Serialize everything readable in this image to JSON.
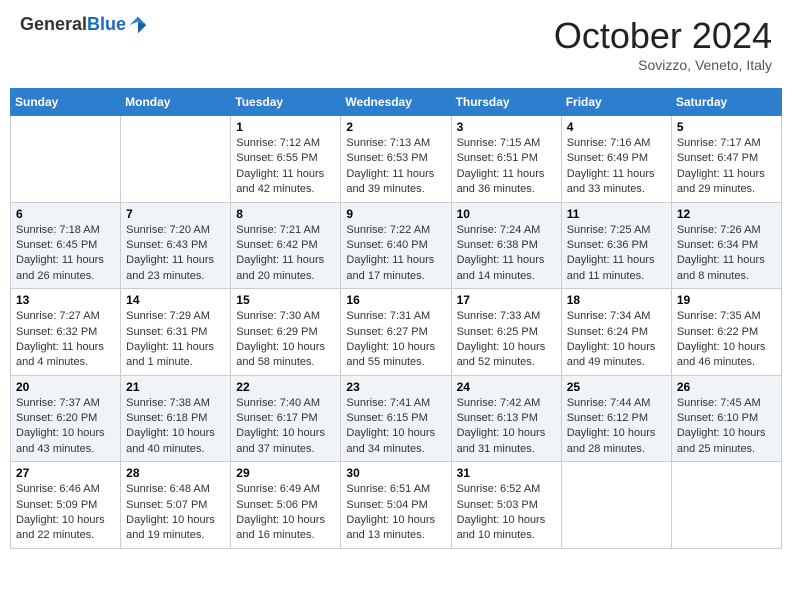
{
  "header": {
    "logo_general": "General",
    "logo_blue": "Blue",
    "month_title": "October 2024",
    "location": "Sovizzo, Veneto, Italy"
  },
  "calendar": {
    "days_of_week": [
      "Sunday",
      "Monday",
      "Tuesday",
      "Wednesday",
      "Thursday",
      "Friday",
      "Saturday"
    ],
    "weeks": [
      [
        {
          "day": "",
          "sunrise": "",
          "sunset": "",
          "daylight": ""
        },
        {
          "day": "",
          "sunrise": "",
          "sunset": "",
          "daylight": ""
        },
        {
          "day": "1",
          "sunrise": "Sunrise: 7:12 AM",
          "sunset": "Sunset: 6:55 PM",
          "daylight": "Daylight: 11 hours and 42 minutes."
        },
        {
          "day": "2",
          "sunrise": "Sunrise: 7:13 AM",
          "sunset": "Sunset: 6:53 PM",
          "daylight": "Daylight: 11 hours and 39 minutes."
        },
        {
          "day": "3",
          "sunrise": "Sunrise: 7:15 AM",
          "sunset": "Sunset: 6:51 PM",
          "daylight": "Daylight: 11 hours and 36 minutes."
        },
        {
          "day": "4",
          "sunrise": "Sunrise: 7:16 AM",
          "sunset": "Sunset: 6:49 PM",
          "daylight": "Daylight: 11 hours and 33 minutes."
        },
        {
          "day": "5",
          "sunrise": "Sunrise: 7:17 AM",
          "sunset": "Sunset: 6:47 PM",
          "daylight": "Daylight: 11 hours and 29 minutes."
        }
      ],
      [
        {
          "day": "6",
          "sunrise": "Sunrise: 7:18 AM",
          "sunset": "Sunset: 6:45 PM",
          "daylight": "Daylight: 11 hours and 26 minutes."
        },
        {
          "day": "7",
          "sunrise": "Sunrise: 7:20 AM",
          "sunset": "Sunset: 6:43 PM",
          "daylight": "Daylight: 11 hours and 23 minutes."
        },
        {
          "day": "8",
          "sunrise": "Sunrise: 7:21 AM",
          "sunset": "Sunset: 6:42 PM",
          "daylight": "Daylight: 11 hours and 20 minutes."
        },
        {
          "day": "9",
          "sunrise": "Sunrise: 7:22 AM",
          "sunset": "Sunset: 6:40 PM",
          "daylight": "Daylight: 11 hours and 17 minutes."
        },
        {
          "day": "10",
          "sunrise": "Sunrise: 7:24 AM",
          "sunset": "Sunset: 6:38 PM",
          "daylight": "Daylight: 11 hours and 14 minutes."
        },
        {
          "day": "11",
          "sunrise": "Sunrise: 7:25 AM",
          "sunset": "Sunset: 6:36 PM",
          "daylight": "Daylight: 11 hours and 11 minutes."
        },
        {
          "day": "12",
          "sunrise": "Sunrise: 7:26 AM",
          "sunset": "Sunset: 6:34 PM",
          "daylight": "Daylight: 11 hours and 8 minutes."
        }
      ],
      [
        {
          "day": "13",
          "sunrise": "Sunrise: 7:27 AM",
          "sunset": "Sunset: 6:32 PM",
          "daylight": "Daylight: 11 hours and 4 minutes."
        },
        {
          "day": "14",
          "sunrise": "Sunrise: 7:29 AM",
          "sunset": "Sunset: 6:31 PM",
          "daylight": "Daylight: 11 hours and 1 minute."
        },
        {
          "day": "15",
          "sunrise": "Sunrise: 7:30 AM",
          "sunset": "Sunset: 6:29 PM",
          "daylight": "Daylight: 10 hours and 58 minutes."
        },
        {
          "day": "16",
          "sunrise": "Sunrise: 7:31 AM",
          "sunset": "Sunset: 6:27 PM",
          "daylight": "Daylight: 10 hours and 55 minutes."
        },
        {
          "day": "17",
          "sunrise": "Sunrise: 7:33 AM",
          "sunset": "Sunset: 6:25 PM",
          "daylight": "Daylight: 10 hours and 52 minutes."
        },
        {
          "day": "18",
          "sunrise": "Sunrise: 7:34 AM",
          "sunset": "Sunset: 6:24 PM",
          "daylight": "Daylight: 10 hours and 49 minutes."
        },
        {
          "day": "19",
          "sunrise": "Sunrise: 7:35 AM",
          "sunset": "Sunset: 6:22 PM",
          "daylight": "Daylight: 10 hours and 46 minutes."
        }
      ],
      [
        {
          "day": "20",
          "sunrise": "Sunrise: 7:37 AM",
          "sunset": "Sunset: 6:20 PM",
          "daylight": "Daylight: 10 hours and 43 minutes."
        },
        {
          "day": "21",
          "sunrise": "Sunrise: 7:38 AM",
          "sunset": "Sunset: 6:18 PM",
          "daylight": "Daylight: 10 hours and 40 minutes."
        },
        {
          "day": "22",
          "sunrise": "Sunrise: 7:40 AM",
          "sunset": "Sunset: 6:17 PM",
          "daylight": "Daylight: 10 hours and 37 minutes."
        },
        {
          "day": "23",
          "sunrise": "Sunrise: 7:41 AM",
          "sunset": "Sunset: 6:15 PM",
          "daylight": "Daylight: 10 hours and 34 minutes."
        },
        {
          "day": "24",
          "sunrise": "Sunrise: 7:42 AM",
          "sunset": "Sunset: 6:13 PM",
          "daylight": "Daylight: 10 hours and 31 minutes."
        },
        {
          "day": "25",
          "sunrise": "Sunrise: 7:44 AM",
          "sunset": "Sunset: 6:12 PM",
          "daylight": "Daylight: 10 hours and 28 minutes."
        },
        {
          "day": "26",
          "sunrise": "Sunrise: 7:45 AM",
          "sunset": "Sunset: 6:10 PM",
          "daylight": "Daylight: 10 hours and 25 minutes."
        }
      ],
      [
        {
          "day": "27",
          "sunrise": "Sunrise: 6:46 AM",
          "sunset": "Sunset: 5:09 PM",
          "daylight": "Daylight: 10 hours and 22 minutes."
        },
        {
          "day": "28",
          "sunrise": "Sunrise: 6:48 AM",
          "sunset": "Sunset: 5:07 PM",
          "daylight": "Daylight: 10 hours and 19 minutes."
        },
        {
          "day": "29",
          "sunrise": "Sunrise: 6:49 AM",
          "sunset": "Sunset: 5:06 PM",
          "daylight": "Daylight: 10 hours and 16 minutes."
        },
        {
          "day": "30",
          "sunrise": "Sunrise: 6:51 AM",
          "sunset": "Sunset: 5:04 PM",
          "daylight": "Daylight: 10 hours and 13 minutes."
        },
        {
          "day": "31",
          "sunrise": "Sunrise: 6:52 AM",
          "sunset": "Sunset: 5:03 PM",
          "daylight": "Daylight: 10 hours and 10 minutes."
        },
        {
          "day": "",
          "sunrise": "",
          "sunset": "",
          "daylight": ""
        },
        {
          "day": "",
          "sunrise": "",
          "sunset": "",
          "daylight": ""
        }
      ]
    ]
  }
}
